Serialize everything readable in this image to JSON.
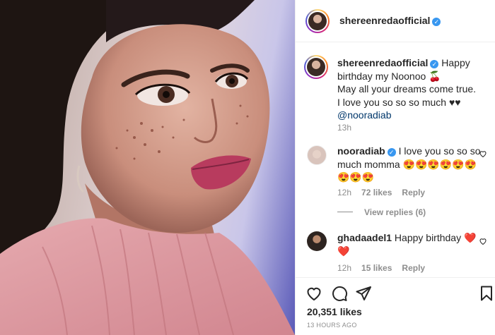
{
  "post": {
    "photo_alt": "",
    "author": {
      "username": "shereenredaofficial",
      "verified": true
    },
    "caption": {
      "line1": "Happy birthday my Noonoo 🍒",
      "line2": "May all your dreams come true.",
      "line3": "I love you so so so much ♥♥",
      "mention": "@nooradiab"
    },
    "caption_time": "13h",
    "comments": [
      {
        "username": "nooradiab",
        "verified": true,
        "text": "I love you so so so much momma 😍😍😍😍😍😍😍😍😍",
        "time": "12h",
        "likes": "72 likes",
        "reply": "Reply"
      },
      {
        "username": "ghadaadel1",
        "verified": false,
        "text": "Happy birthday ❤️ ❤️",
        "time": "12h",
        "likes": "15 likes",
        "reply": "Reply"
      }
    ],
    "view_replies": "View replies (6)",
    "likes": "20,351 likes",
    "posted_ago": "13 HOURS AGO"
  },
  "icons": {
    "like": "heart-outline-icon",
    "comment": "comment-icon",
    "share": "paper-plane-icon",
    "save": "bookmark-icon",
    "verified": "verified-badge-icon"
  },
  "colors": {
    "verified": "#3897f0",
    "meta": "#8e8e8e",
    "mention": "#00376b",
    "heart": "#ed4956"
  }
}
